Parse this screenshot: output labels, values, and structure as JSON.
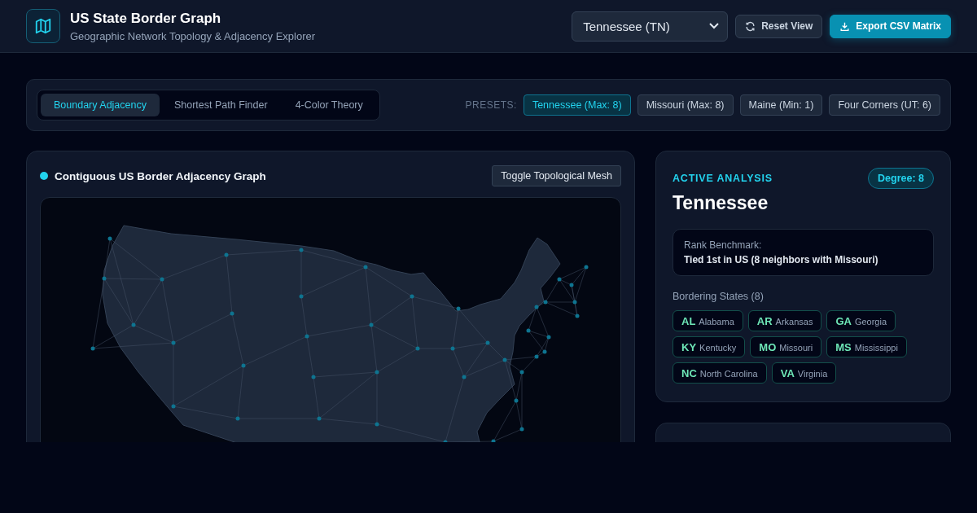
{
  "header": {
    "title": "US State Border Graph",
    "subtitle": "Geographic Network Topology & Adjacency Explorer",
    "state_select": {
      "value": "Tennessee (TN)"
    },
    "buttons": [
      {
        "kind": "secondary",
        "label": "Reset View"
      },
      {
        "kind": "primary",
        "label": "Export CSV Matrix"
      }
    ]
  },
  "toolbar": {
    "tabs": [
      {
        "label": "Boundary Adjacency",
        "selected": true
      },
      {
        "label": "Shortest Path Finder",
        "selected": false
      },
      {
        "label": "4-Color Theory",
        "selected": false
      }
    ],
    "presets_label": "PRESETS:",
    "presets": [
      {
        "label": "Tennessee (Max: 8)",
        "selected": true
      },
      {
        "label": "Missouri (Max: 8)",
        "selected": false
      },
      {
        "label": "Maine (Min: 1)",
        "selected": false
      },
      {
        "label": "Four Corners (UT: 6)",
        "selected": false
      }
    ]
  },
  "graph_card": {
    "title": "Contiguous US Border Adjacency Graph",
    "toggle_button": "Toggle Topological Mesh"
  },
  "analysis": {
    "eyebrow": "ACTIVE ANALYSIS",
    "degree": "Degree: 8",
    "state": "Tennessee",
    "rank_label": "Rank Benchmark:",
    "rank_value": "Tied 1st in US (8 neighbors with Missouri)",
    "neighbors_title": "Bordering States (8)",
    "neighbors": [
      {
        "code": "AL",
        "name": "Alabama"
      },
      {
        "code": "AR",
        "name": "Arkansas"
      },
      {
        "code": "GA",
        "name": "Georgia"
      },
      {
        "code": "KY",
        "name": "Kentucky"
      },
      {
        "code": "MO",
        "name": "Missouri"
      },
      {
        "code": "MS",
        "name": "Mississippi"
      },
      {
        "code": "NC",
        "name": "North Carolina"
      },
      {
        "code": "VA",
        "name": "Virginia"
      }
    ]
  }
}
